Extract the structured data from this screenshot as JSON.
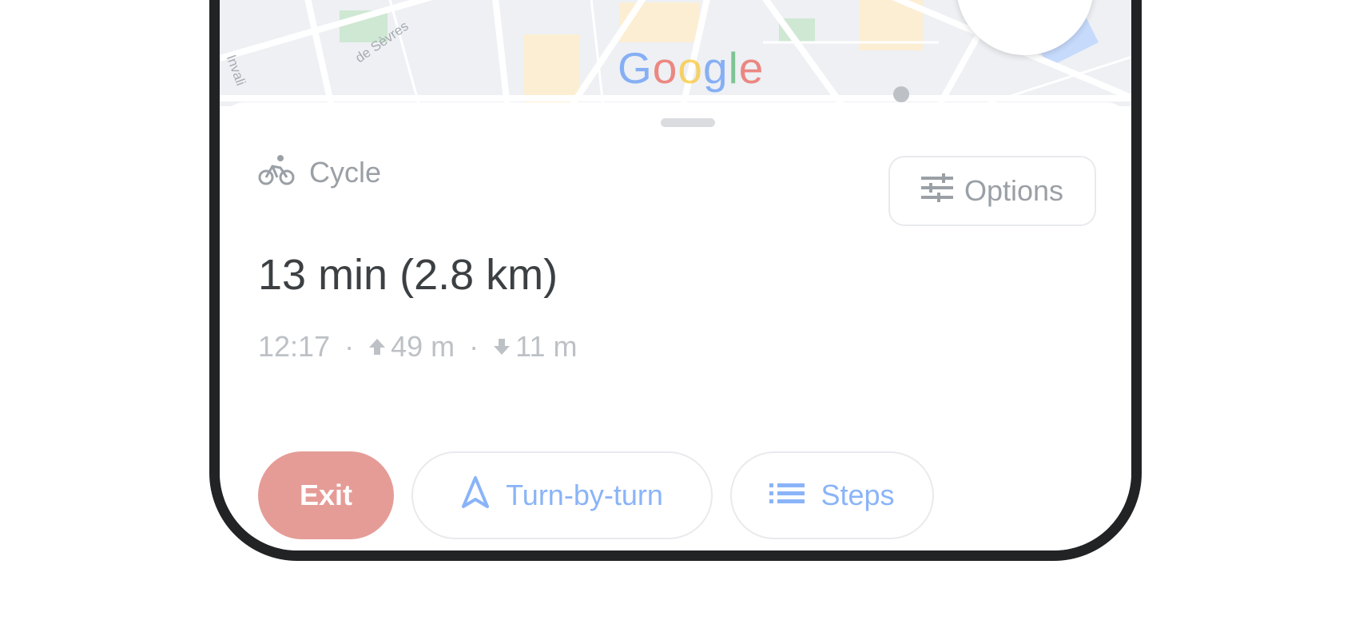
{
  "map": {
    "street_label_1": "de Sèvres",
    "street_label_2": "Invali",
    "logo_text": "Google",
    "logo_colors": [
      "#4285f4",
      "#ea4335",
      "#fbbc05",
      "#4285f4",
      "#34a853",
      "#ea4335"
    ]
  },
  "mode": {
    "icon": "bicycle-icon",
    "label": "Cycle"
  },
  "options": {
    "icon": "tune-sliders-icon",
    "label": "Options"
  },
  "route": {
    "duration": "13 min (2.8 km)",
    "arrival": "12:17",
    "separator": "·",
    "ascent": "49 m",
    "descent": "11 m"
  },
  "actions": {
    "exit_label": "Exit",
    "turn_label": "Turn-by-turn",
    "turn_icon": "navigation-arrow-icon",
    "steps_label": "Steps",
    "steps_icon": "list-icon"
  },
  "colors": {
    "exit": "#e59c97",
    "accent": "#8ab4f8",
    "text_primary": "#3c4043",
    "text_secondary": "#9aa0a6"
  }
}
